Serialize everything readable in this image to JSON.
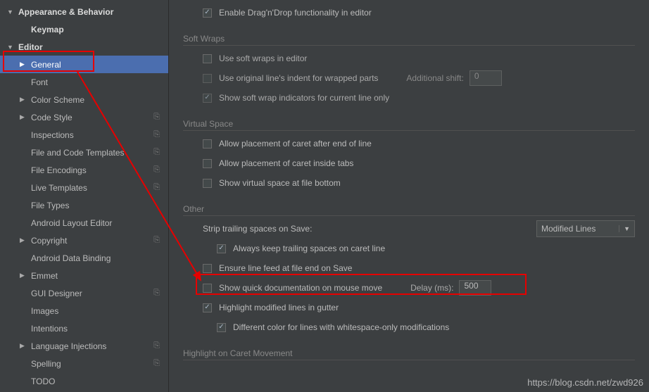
{
  "sidebar": {
    "items": [
      {
        "label": "Appearance & Behavior",
        "arrow": "▼",
        "bold": true,
        "indent": 0,
        "cfg": false
      },
      {
        "label": "Keymap",
        "arrow": "",
        "bold": true,
        "indent": 1,
        "cfg": false
      },
      {
        "label": "Editor",
        "arrow": "▼",
        "bold": true,
        "indent": 0,
        "cfg": false
      },
      {
        "label": "General",
        "arrow": "▶",
        "bold": false,
        "indent": 1,
        "cfg": false,
        "selected": true
      },
      {
        "label": "Font",
        "arrow": "",
        "bold": false,
        "indent": 1,
        "cfg": false
      },
      {
        "label": "Color Scheme",
        "arrow": "▶",
        "bold": false,
        "indent": 1,
        "cfg": false
      },
      {
        "label": "Code Style",
        "arrow": "▶",
        "bold": false,
        "indent": 1,
        "cfg": true
      },
      {
        "label": "Inspections",
        "arrow": "",
        "bold": false,
        "indent": 1,
        "cfg": true
      },
      {
        "label": "File and Code Templates",
        "arrow": "",
        "bold": false,
        "indent": 1,
        "cfg": true
      },
      {
        "label": "File Encodings",
        "arrow": "",
        "bold": false,
        "indent": 1,
        "cfg": true
      },
      {
        "label": "Live Templates",
        "arrow": "",
        "bold": false,
        "indent": 1,
        "cfg": true
      },
      {
        "label": "File Types",
        "arrow": "",
        "bold": false,
        "indent": 1,
        "cfg": false
      },
      {
        "label": "Android Layout Editor",
        "arrow": "",
        "bold": false,
        "indent": 1,
        "cfg": false
      },
      {
        "label": "Copyright",
        "arrow": "▶",
        "bold": false,
        "indent": 1,
        "cfg": true
      },
      {
        "label": "Android Data Binding",
        "arrow": "",
        "bold": false,
        "indent": 1,
        "cfg": false
      },
      {
        "label": "Emmet",
        "arrow": "▶",
        "bold": false,
        "indent": 1,
        "cfg": false
      },
      {
        "label": "GUI Designer",
        "arrow": "",
        "bold": false,
        "indent": 1,
        "cfg": true
      },
      {
        "label": "Images",
        "arrow": "",
        "bold": false,
        "indent": 1,
        "cfg": false
      },
      {
        "label": "Intentions",
        "arrow": "",
        "bold": false,
        "indent": 1,
        "cfg": false
      },
      {
        "label": "Language Injections",
        "arrow": "▶",
        "bold": false,
        "indent": 1,
        "cfg": true
      },
      {
        "label": "Spelling",
        "arrow": "",
        "bold": false,
        "indent": 1,
        "cfg": true
      },
      {
        "label": "TODO",
        "arrow": "",
        "bold": false,
        "indent": 1,
        "cfg": false
      }
    ]
  },
  "main": {
    "dragdrop": {
      "label": "Enable Drag'n'Drop functionality in editor",
      "checked": true
    },
    "softwraps_title": "Soft Wraps",
    "sw1": {
      "label": "Use soft wraps in editor",
      "checked": false
    },
    "sw2": {
      "label": "Use original line's indent for wrapped parts",
      "checked": false,
      "shift_label": "Additional shift:",
      "shift_val": "0"
    },
    "sw3": {
      "label": "Show soft wrap indicators for current line only",
      "checked": true
    },
    "virtual_title": "Virtual Space",
    "vs1": {
      "label": "Allow placement of caret after end of line",
      "checked": false
    },
    "vs2": {
      "label": "Allow placement of caret inside tabs",
      "checked": false
    },
    "vs3": {
      "label": "Show virtual space at file bottom",
      "checked": false
    },
    "other_title": "Other",
    "strip_label": "Strip trailing spaces on Save:",
    "strip_value": "Modified Lines",
    "ot1": {
      "label": "Always keep trailing spaces on caret line",
      "checked": true
    },
    "ot2": {
      "label": "Ensure line feed at file end on Save",
      "checked": false
    },
    "ot3": {
      "label": "Show quick documentation on mouse move",
      "checked": false,
      "delay_label": "Delay (ms):",
      "delay_val": "500"
    },
    "ot4": {
      "label": "Highlight modified lines in gutter",
      "checked": true
    },
    "ot5": {
      "label": "Different color for lines with whitespace-only modifications",
      "checked": true
    },
    "highlight_title": "Highlight on Caret Movement"
  },
  "watermark": "https://blog.csdn.net/zwd926"
}
